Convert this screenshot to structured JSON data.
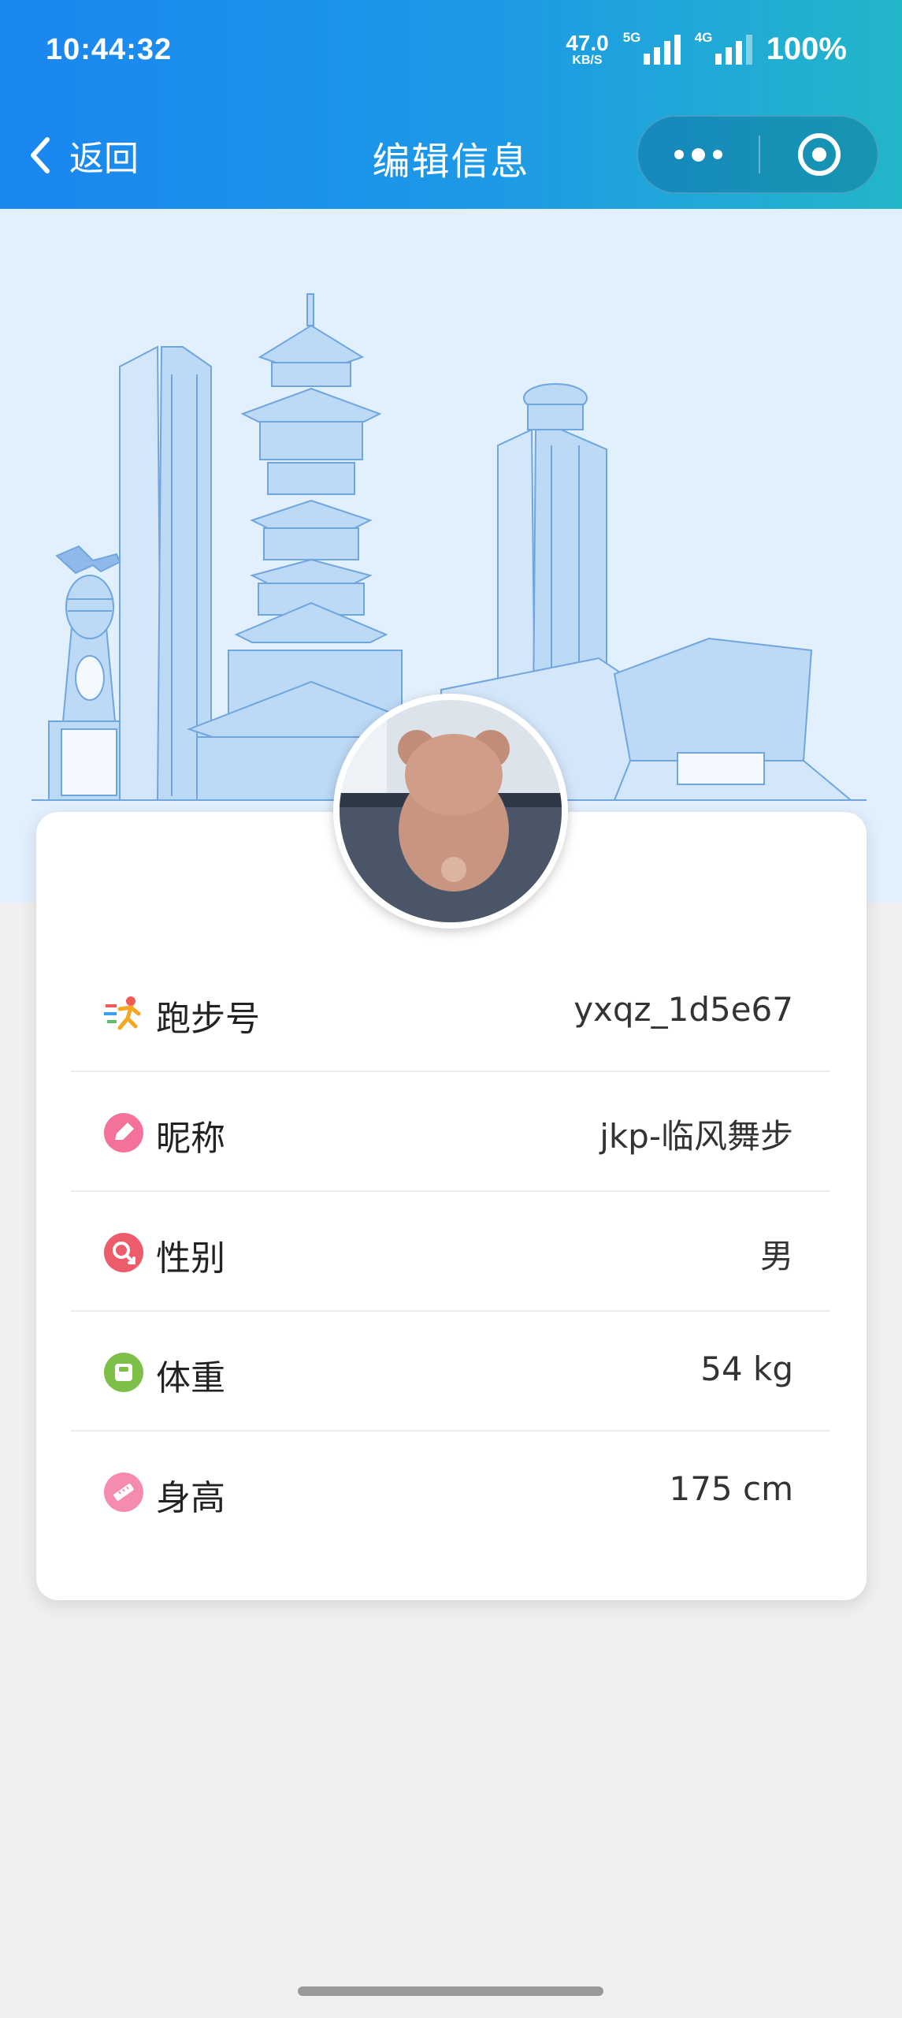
{
  "status_bar": {
    "time": "10:44:32",
    "net_speed": "47.0",
    "net_speed_unit": "KB/S",
    "sim1_tag": "5G",
    "sim2_tag": "4G",
    "battery": "100%"
  },
  "nav": {
    "back_label": "返回",
    "title": "编辑信息",
    "accent_start": "#1a86f0",
    "accent_end": "#22b6c9"
  },
  "profile": {
    "rows": [
      {
        "icon": "runner-icon",
        "label": "跑步号",
        "value": "yxqz_1d5e67"
      },
      {
        "icon": "pencil-icon",
        "label": "昵称",
        "value": "jkp-临风舞步"
      },
      {
        "icon": "gender-icon",
        "label": "性别",
        "value": "男"
      },
      {
        "icon": "scale-icon",
        "label": "体重",
        "value": "54 kg"
      },
      {
        "icon": "ruler-icon",
        "label": "身高",
        "value": "175 cm"
      }
    ]
  }
}
